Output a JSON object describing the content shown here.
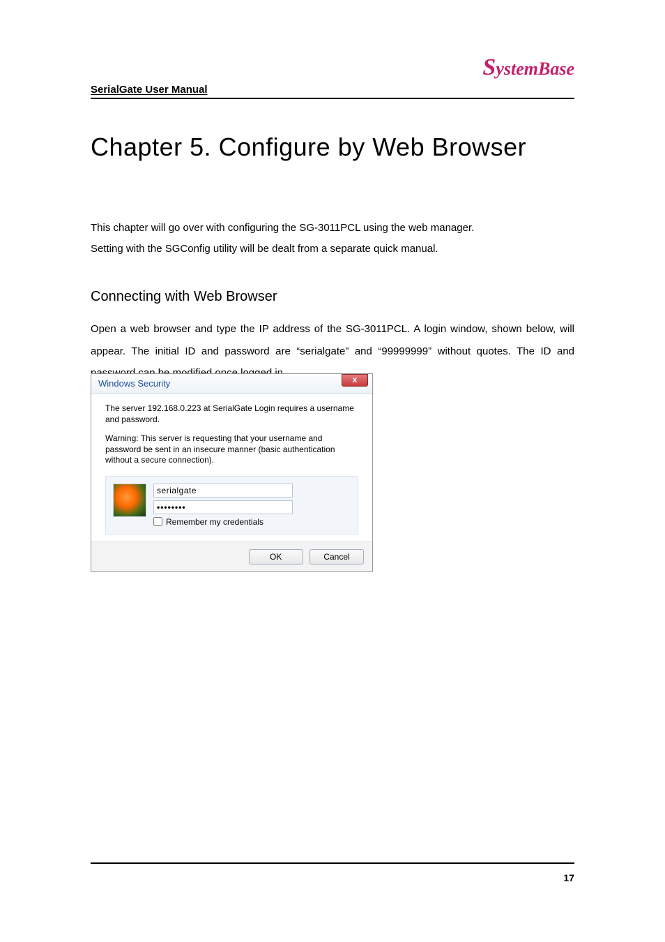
{
  "brand": {
    "prefix": "S",
    "rest": "ystemBase"
  },
  "header": "SerialGate User Manual",
  "chapter_title": "Chapter 5. Configure by Web Browser",
  "intro_line1": "This chapter will go over with configuring the SG-3011PCL using the web manager.",
  "intro_line2": "Setting with the SGConfig utility will be dealt from a separate quick manual.",
  "section_title": "Connecting with Web Browser",
  "section_body": "Open a web browser and type the IP address of the SG-3011PCL. A login window, shown below, will appear. The initial ID and password are “serialgate” and “99999999” without quotes. The ID and password can be modified once logged in.",
  "dialog": {
    "title": "Windows Security",
    "close_glyph": "x",
    "msg1": "The server 192.168.0.223 at SerialGate Login requires a username and password.",
    "msg2": "Warning: This server is requesting that your username and password be sent in an insecure manner (basic authentication without a secure connection).",
    "username_value": "serialgate",
    "password_value": "••••••••",
    "remember_label": "Remember my credentials",
    "ok_label": "OK",
    "cancel_label": "Cancel"
  },
  "page_number": "17"
}
